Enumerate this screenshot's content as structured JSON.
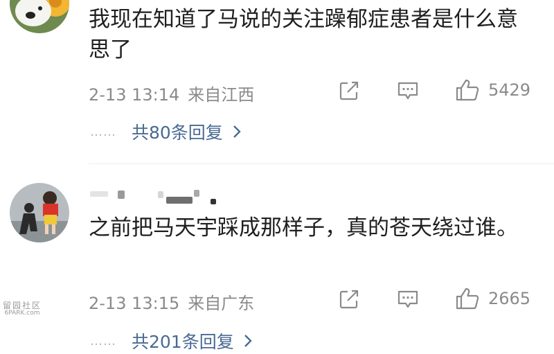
{
  "comments": [
    {
      "text": "我现在知道了马说的关注躁郁症患者是什么意思了",
      "date": "2-13 13:14",
      "location": "来自江西",
      "likes": "5429",
      "replies_label": "共80条回复",
      "dots": "……"
    },
    {
      "text": "之前把马天宇踩成那样子，真的苍天绕过谁。",
      "date": "2-13 13:15",
      "location": "来自广东",
      "likes": "2665",
      "replies_label": "共201条回复",
      "dots": "……"
    }
  ],
  "watermark": {
    "top": "留园社区",
    "bottom": "6PARK.com"
  },
  "colors": {
    "text": "#1f1f1f",
    "meta": "#8a8a8a",
    "link": "#496a93",
    "divider": "#ececec"
  },
  "icons": [
    "share-icon",
    "comment-icon",
    "like-icon",
    "chevron-right-icon"
  ]
}
